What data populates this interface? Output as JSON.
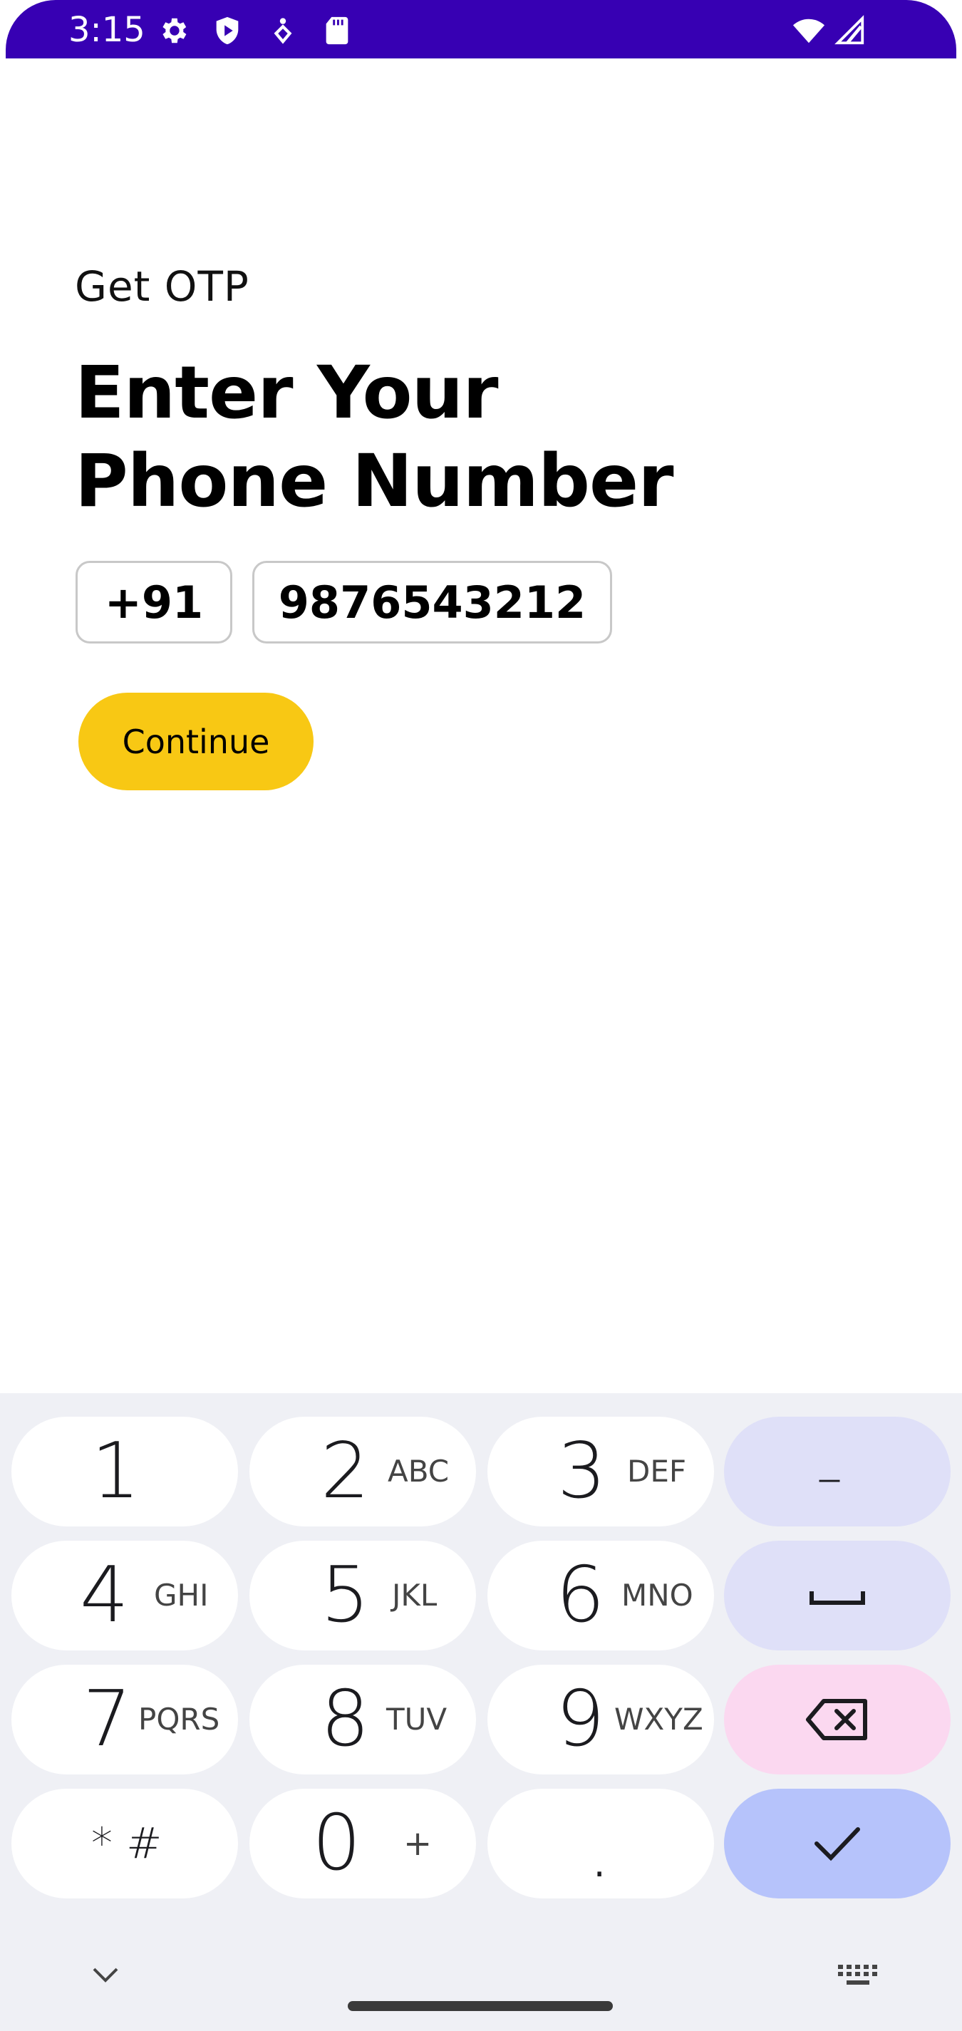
{
  "status_bar": {
    "time": "3:15",
    "color": "#3700b3",
    "left_icons": [
      "settings-gear-icon",
      "play-protect-icon",
      "accessibility-icon",
      "sd-card-icon"
    ],
    "right_icons": [
      "wifi-icon",
      "signal-icon"
    ]
  },
  "screen": {
    "subtitle": "Get OTP",
    "title_line1": "Enter Your",
    "title_line2": "Phone Number",
    "country_code": "+91",
    "phone_number": "9876543212",
    "continue_label": "Continue",
    "accent_color": "#f8c814"
  },
  "keyboard": {
    "keys": [
      {
        "digit": "1",
        "letters": ""
      },
      {
        "digit": "2",
        "letters": "ABC"
      },
      {
        "digit": "3",
        "letters": "DEF"
      },
      {
        "digit": "4",
        "letters": "GHI"
      },
      {
        "digit": "5",
        "letters": "JKL"
      },
      {
        "digit": "6",
        "letters": "MNO"
      },
      {
        "digit": "7",
        "letters": "PQRS"
      },
      {
        "digit": "8",
        "letters": "TUV"
      },
      {
        "digit": "9",
        "letters": "WXYZ"
      },
      {
        "digit": "* #",
        "letters": ""
      },
      {
        "digit": "0",
        "letters": "+"
      },
      {
        "digit": ".",
        "letters": ""
      }
    ],
    "side_keys": [
      "dash-key",
      "space-key",
      "backspace-key",
      "done-key"
    ],
    "dash_label": "–",
    "bottom_icons": [
      "collapse-chevron-icon",
      "keyboard-switch-icon"
    ]
  }
}
